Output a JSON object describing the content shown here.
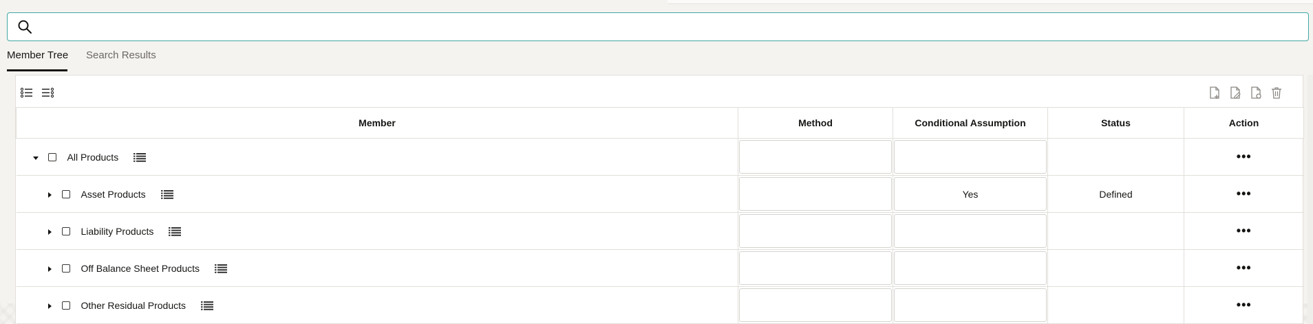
{
  "search": {
    "placeholder": "",
    "value": ""
  },
  "tabs": [
    {
      "label": "Member Tree",
      "active": true
    },
    {
      "label": "Search Results",
      "active": false
    }
  ],
  "toolbar": {
    "left_icons": [
      "expand-all-icon",
      "collapse-all-icon"
    ],
    "right_icons": [
      "add-document-icon",
      "edit-document-icon",
      "view-document-icon",
      "delete-icon"
    ]
  },
  "table": {
    "columns": [
      "Member",
      "Method",
      "Conditional Assumption",
      "Status",
      "Action"
    ],
    "rows": [
      {
        "member": "All Products",
        "expanded": true,
        "method": "",
        "conditional_assumption": "",
        "status": "",
        "action": "•••"
      },
      {
        "member": "Asset Products",
        "expanded": false,
        "method": "",
        "conditional_assumption": "Yes",
        "status": "Defined",
        "action": "•••"
      },
      {
        "member": "Liability Products",
        "expanded": false,
        "method": "",
        "conditional_assumption": "",
        "status": "",
        "action": "•••"
      },
      {
        "member": "Off Balance Sheet Products",
        "expanded": false,
        "method": "",
        "conditional_assumption": "",
        "status": "",
        "action": "•••"
      },
      {
        "member": "Other Residual Products",
        "expanded": false,
        "method": "",
        "conditional_assumption": "",
        "status": "",
        "action": "•••"
      }
    ]
  },
  "colors": {
    "accent": "#3fa7a3",
    "border": "#e2dfda",
    "text": "#161513",
    "background": "#f5f3f0"
  }
}
